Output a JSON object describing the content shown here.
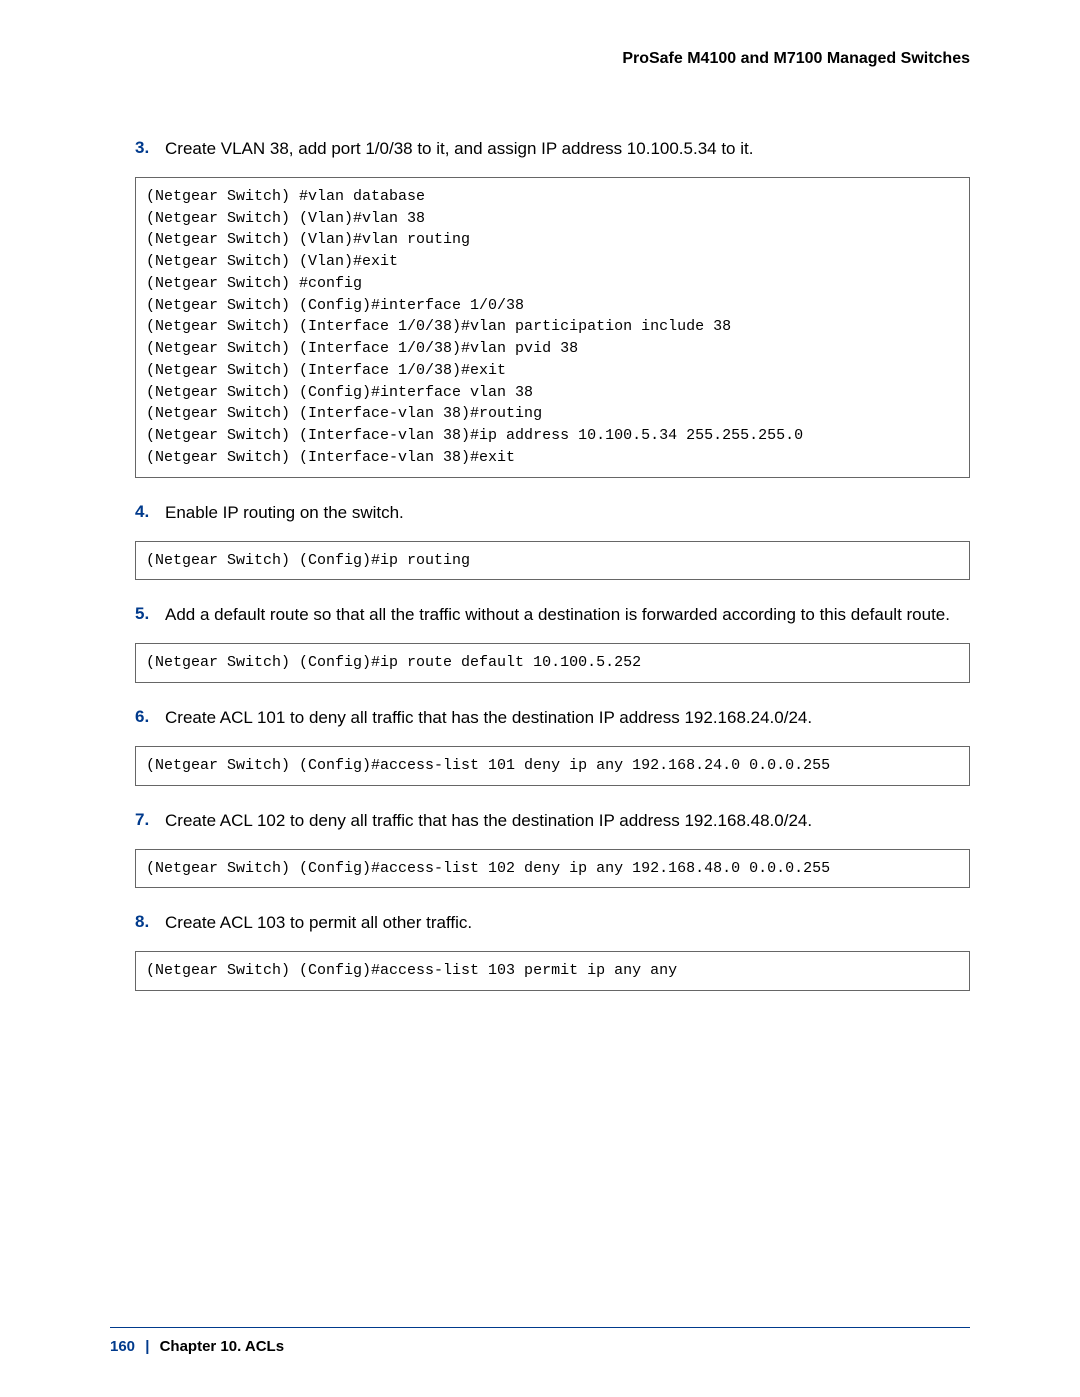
{
  "header": {
    "title": "ProSafe M4100 and M7100 Managed Switches"
  },
  "steps": [
    {
      "num": "3.",
      "text": "Create VLAN 38, add port 1/0/38 to it, and assign IP address 10.100.5.34 to it.",
      "code": "(Netgear Switch) #vlan database\n(Netgear Switch) (Vlan)#vlan 38\n(Netgear Switch) (Vlan)#vlan routing\n(Netgear Switch) (Vlan)#exit\n(Netgear Switch) #config\n(Netgear Switch) (Config)#interface 1/0/38\n(Netgear Switch) (Interface 1/0/38)#vlan participation include 38\n(Netgear Switch) (Interface 1/0/38)#vlan pvid 38\n(Netgear Switch) (Interface 1/0/38)#exit\n(Netgear Switch) (Config)#interface vlan 38\n(Netgear Switch) (Interface-vlan 38)#routing\n(Netgear Switch) (Interface-vlan 38)#ip address 10.100.5.34 255.255.255.0\n(Netgear Switch) (Interface-vlan 38)#exit"
    },
    {
      "num": "4.",
      "text": "Enable IP routing on the switch.",
      "code": "(Netgear Switch) (Config)#ip routing"
    },
    {
      "num": "5.",
      "text": "Add a default route so that all the traffic without a destination is forwarded according to this default route.",
      "code": "(Netgear Switch) (Config)#ip route default 10.100.5.252"
    },
    {
      "num": "6.",
      "text": "Create ACL 101 to deny all traffic that has the destination IP address 192.168.24.0/24.",
      "code": "(Netgear Switch) (Config)#access-list 101 deny ip any 192.168.24.0 0.0.0.255"
    },
    {
      "num": "7.",
      "text": "Create ACL 102 to deny all traffic that has the destination IP address 192.168.48.0/24.",
      "code": "(Netgear Switch) (Config)#access-list 102 deny ip any 192.168.48.0 0.0.0.255"
    },
    {
      "num": "8.",
      "text": "Create ACL 103 to permit all other traffic.",
      "code": "(Netgear Switch) (Config)#access-list 103 permit ip any any"
    }
  ],
  "footer": {
    "page": "160",
    "sep": "|",
    "chapter": "Chapter 10.  ACLs"
  }
}
